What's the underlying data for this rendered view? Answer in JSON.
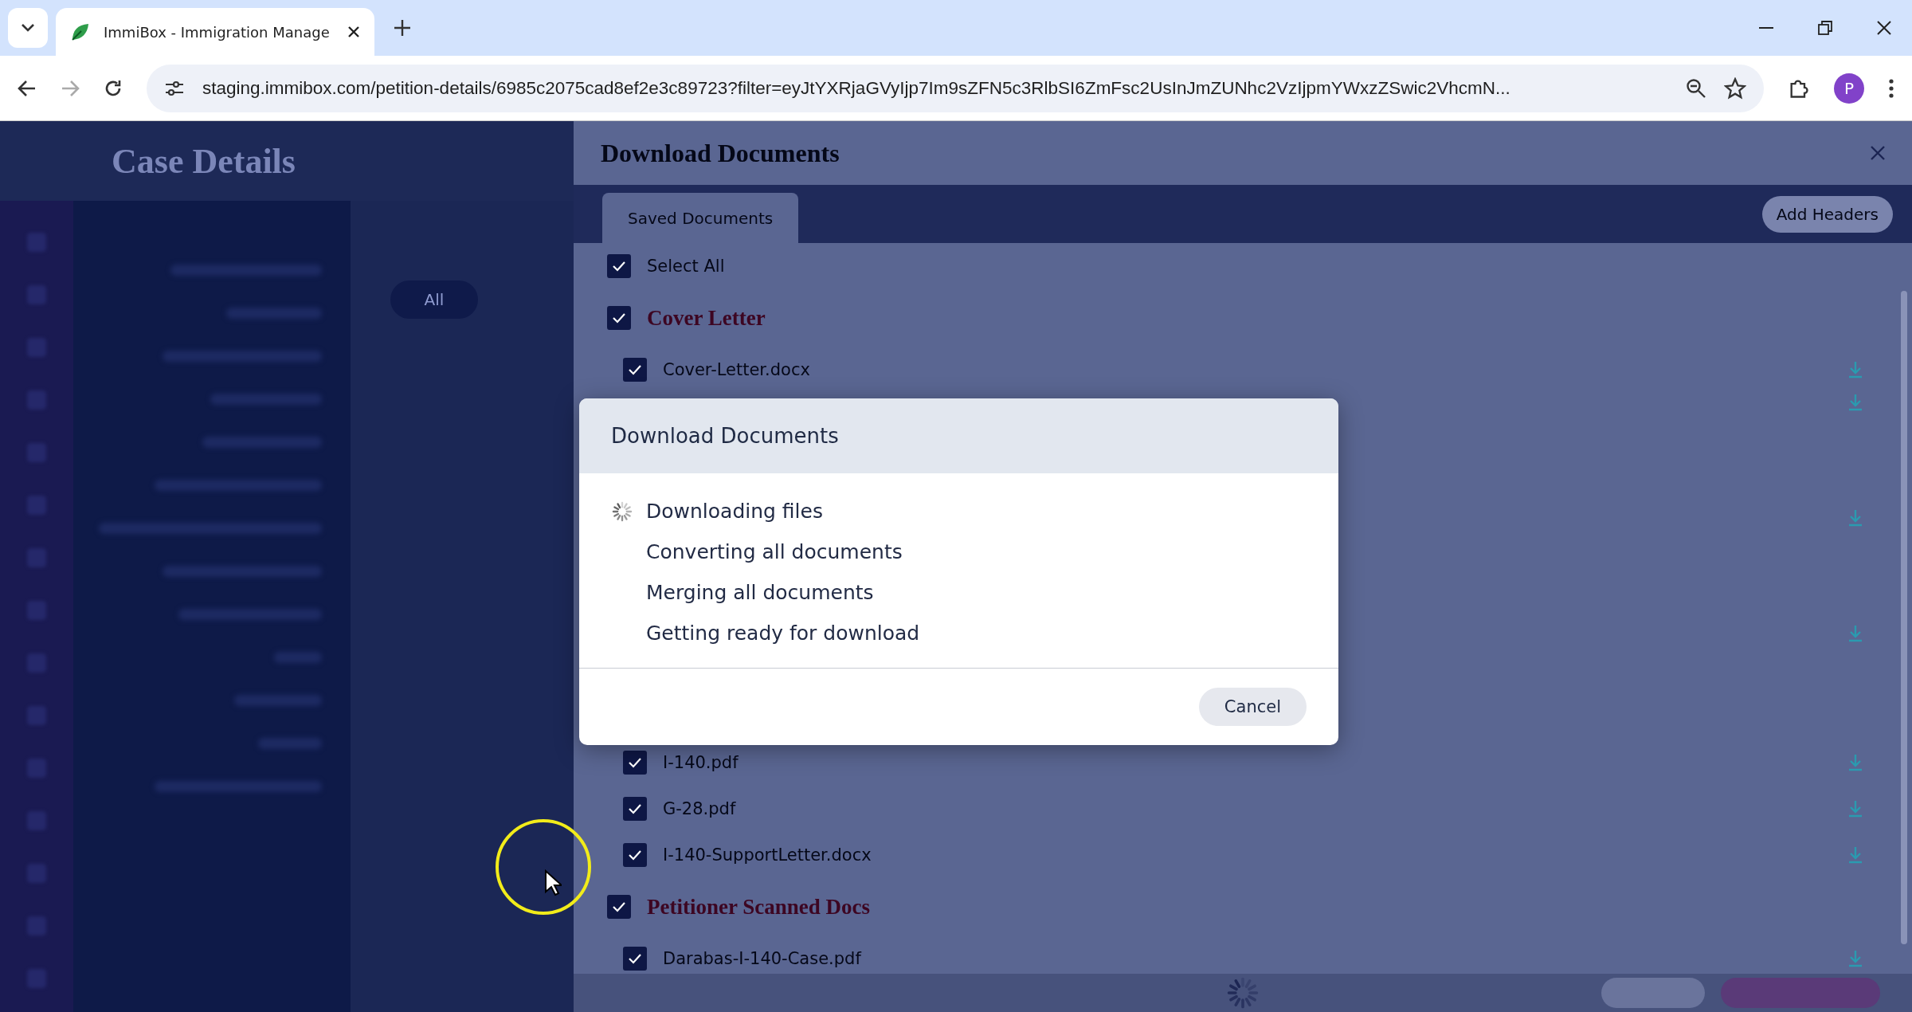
{
  "browser": {
    "tab_title": "ImmiBox - Immigration Manage",
    "url": "staging.immibox.com/petition-details/6985c2075cad8ef2e3c89723?filter=eyJtYXRjaGVyIjp7Im9sZFN5c3RlbSI6ZmFsc2UsInJmZUNhc2VzIjpmYWxzZSwic2VhcmN...",
    "profile_initial": "P"
  },
  "background": {
    "page_title": "Case Details",
    "filter_pill": "All"
  },
  "drawer": {
    "title": "Download Documents",
    "tabs": [
      {
        "label": "Saved Documents",
        "selected": true
      }
    ],
    "add_headers": "Add Headers",
    "select_all": {
      "label": "Select All",
      "checked": true
    },
    "rows": [
      {
        "kind": "section",
        "title": "Cover Letter",
        "checked": true
      },
      {
        "kind": "file",
        "name": "Cover-Letter.docx",
        "checked": true
      },
      {
        "kind": "covered"
      },
      {
        "kind": "covered"
      },
      {
        "kind": "covered"
      },
      {
        "kind": "file",
        "name": "I-140.pdf",
        "checked": true
      },
      {
        "kind": "file",
        "name": "G-28.pdf",
        "checked": true
      },
      {
        "kind": "file",
        "name": "I-140-SupportLetter.docx",
        "checked": true
      },
      {
        "kind": "section",
        "title": "Petitioner Scanned Docs",
        "checked": true
      },
      {
        "kind": "file",
        "name": "Darabas-I-140-Case.pdf",
        "checked": true
      }
    ]
  },
  "modal": {
    "title": "Download Documents",
    "steps": [
      {
        "label": "Downloading files",
        "active": true
      },
      {
        "label": "Converting all documents",
        "active": false
      },
      {
        "label": "Merging all documents",
        "active": false
      },
      {
        "label": "Getting ready for download",
        "active": false
      }
    ],
    "cancel": "Cancel"
  }
}
